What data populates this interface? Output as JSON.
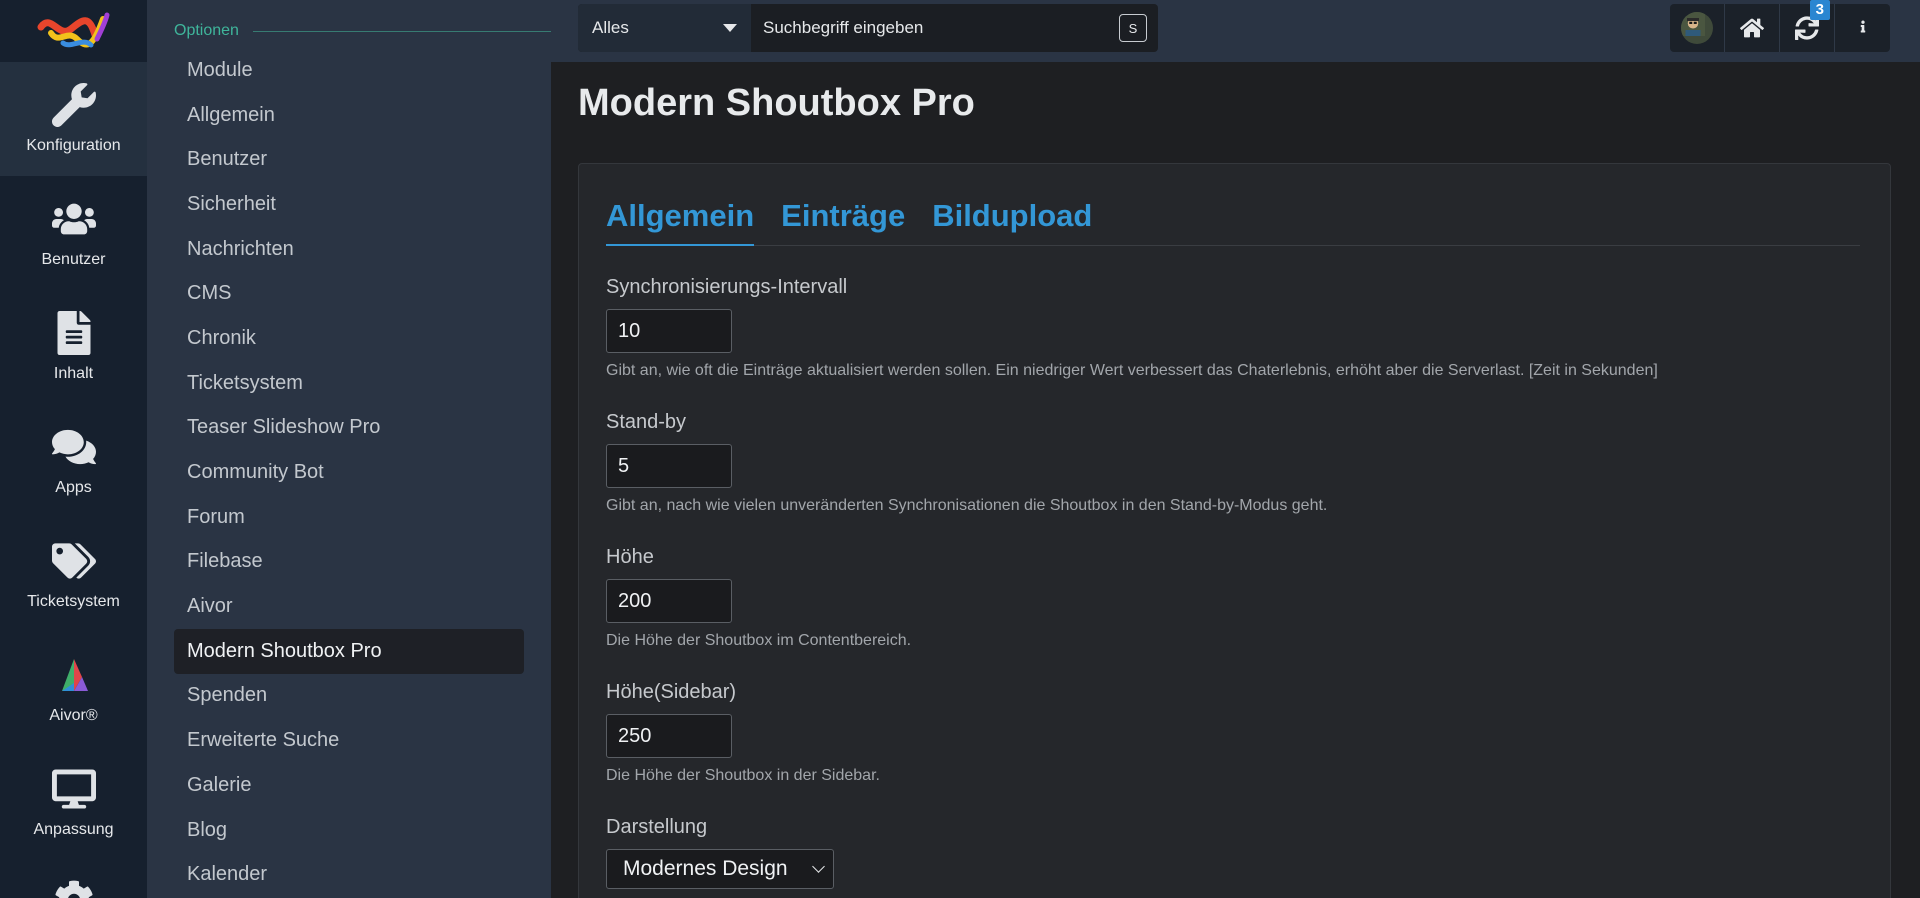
{
  "rail": {
    "items": [
      {
        "label": "Konfiguration",
        "icon": "wrench-icon",
        "active": true
      },
      {
        "label": "Benutzer",
        "icon": "users-icon"
      },
      {
        "label": "Inhalt",
        "icon": "file-icon"
      },
      {
        "label": "Apps",
        "icon": "comments-icon"
      },
      {
        "label": "Ticketsystem",
        "icon": "tags-icon"
      },
      {
        "label": "Aivor®",
        "icon": "aivor-logo-icon"
      },
      {
        "label": "Anpassung",
        "icon": "desktop-icon"
      },
      {
        "label": "",
        "icon": "cog-icon"
      }
    ]
  },
  "options": {
    "title": "Optionen",
    "items": [
      "Module",
      "Allgemein",
      "Benutzer",
      "Sicherheit",
      "Nachrichten",
      "CMS",
      "Chronik",
      "Ticketsystem",
      "Teaser Slideshow Pro",
      "Community Bot",
      "Forum",
      "Filebase",
      "Aivor",
      "Modern Shoutbox Pro",
      "Spenden",
      "Erweiterte Suche",
      "Galerie",
      "Blog",
      "Kalender"
    ],
    "active_index": 13
  },
  "search": {
    "scope": "Alles",
    "placeholder": "Suchbegriff eingeben",
    "shortcut": "S"
  },
  "actions": {
    "update_badge": "3"
  },
  "page": {
    "title": "Modern Shoutbox Pro",
    "tabs": [
      "Allgemein",
      "Einträge",
      "Bildupload"
    ]
  },
  "fields": [
    {
      "label": "Synchronisierungs-Intervall",
      "value": "10",
      "desc": "Gibt an, wie oft die Einträge aktualisiert werden sollen. Ein niedriger Wert verbessert das Chaterlebnis, erhöht aber die Serverlast. [Zeit in Sekunden]"
    },
    {
      "label": "Stand-by",
      "value": "5",
      "desc": "Gibt an, nach wie vielen unveränderten Synchronisationen die Shoutbox in den Stand-by-Modus geht."
    },
    {
      "label": "Höhe",
      "value": "200",
      "desc": "Die Höhe der Shoutbox im Contentbereich."
    },
    {
      "label": "Höhe(Sidebar)",
      "value": "250",
      "desc": "Die Höhe der Shoutbox in der Sidebar."
    },
    {
      "label": "Darstellung",
      "value": "Modernes Design"
    }
  ],
  "colors": {
    "accent": "#3397d6",
    "sidebar_title": "#3fb59b",
    "rail_bg": "#16202e",
    "sidebar_bg": "#2a3444"
  }
}
